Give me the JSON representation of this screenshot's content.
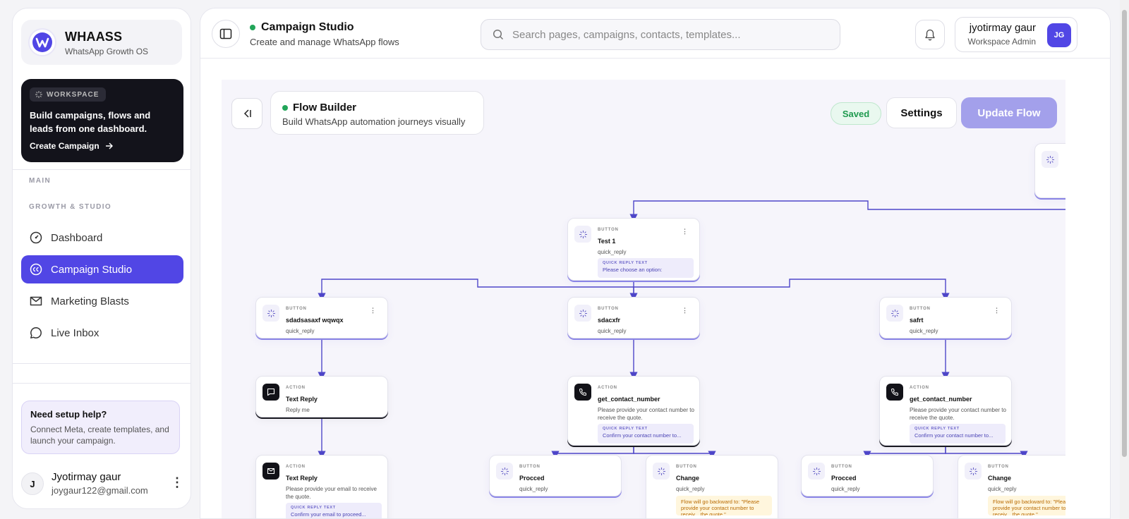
{
  "brand": {
    "name": "WHAASS",
    "tagline": "WhatsApp Growth OS"
  },
  "promo": {
    "tag": "WORKSPACE",
    "title": "Build campaigns, flows and leads from one dashboard.",
    "cta": "Create Campaign"
  },
  "sidebar": {
    "section_main": "MAIN",
    "section_growth": "GROWTH & STUDIO",
    "items": [
      {
        "label": "Dashboard",
        "icon": "gauge-icon",
        "active": false
      },
      {
        "label": "Campaign Studio",
        "icon": "cc-icon",
        "active": true
      },
      {
        "label": "Marketing Blasts",
        "icon": "envelope-icon",
        "active": false
      },
      {
        "label": "Live Inbox",
        "icon": "chat-bubble-icon",
        "active": false
      }
    ],
    "help": {
      "title": "Need setup help?",
      "text": "Connect Meta, create templates, and launch your campaign."
    },
    "user": {
      "initial": "J",
      "name": "Jyotirmay gaur",
      "email": "joygaur122@gmail.com"
    }
  },
  "header": {
    "title": "Campaign Studio",
    "subtitle": "Create and manage WhatsApp flows",
    "search_placeholder": "Search pages, campaigns, contacts, templates...",
    "account_name": "jyotirmay gaur",
    "account_role": "Workspace Admin",
    "account_initials": "JG"
  },
  "builder": {
    "title": "Flow Builder",
    "subtitle": "Build WhatsApp automation journeys visually",
    "status": "Saved",
    "settings_label": "Settings",
    "update_label": "Update Flow"
  },
  "nodes": {
    "test1": {
      "kind": "BUTTON",
      "title": "Test 1",
      "sub": "quick_reply",
      "box_label": "QUICK REPLY TEXT",
      "box_text": "Please choose an option:"
    },
    "b1": {
      "kind": "BUTTON",
      "title": "sdadsasaxf wqwqx",
      "sub": "quick_reply"
    },
    "b2": {
      "kind": "BUTTON",
      "title": "sdacxfr",
      "sub": "quick_reply"
    },
    "b3": {
      "kind": "BUTTON",
      "title": "safrt",
      "sub": "quick_reply"
    },
    "a1": {
      "kind": "ACTION",
      "title": "Text Reply",
      "sub": "Reply me"
    },
    "a2": {
      "kind": "ACTION",
      "title": "get_contact_number",
      "sub": "Please provide your contact number to receive the quote.",
      "box_label": "QUICK REPLY TEXT",
      "box_text": "Confirm your contact number to..."
    },
    "a3": {
      "kind": "ACTION",
      "title": "get_contact_number",
      "sub": "Please provide your contact number to receive the quote.",
      "box_label": "QUICK REPLY TEXT",
      "box_text": "Confirm your contact number to..."
    },
    "a4": {
      "kind": "ACTION",
      "title": "Text Reply",
      "sub": "Please provide your email to receive the quote.",
      "box_label": "QUICK REPLY TEXT",
      "box_text": "Confirm your email to proceed..."
    },
    "p1": {
      "kind": "BUTTON",
      "title": "Procced",
      "sub": "quick_reply"
    },
    "c1": {
      "kind": "BUTTON",
      "title": "Change",
      "sub": "quick_reply",
      "box_text": "Flow will go backward to: \"Please provide your contact number to receiv... the quote.\""
    },
    "p2": {
      "kind": "BUTTON",
      "title": "Procced",
      "sub": "quick_reply"
    },
    "c2": {
      "kind": "BUTTON",
      "title": "Change",
      "sub": "quick_reply",
      "box_text": "Flow will go backward to: \"Please provide your contact number to receiv... the quote.\""
    }
  },
  "colors": {
    "accent": "#5146e5",
    "edge": "#4f47c9",
    "online": "#22a559"
  }
}
